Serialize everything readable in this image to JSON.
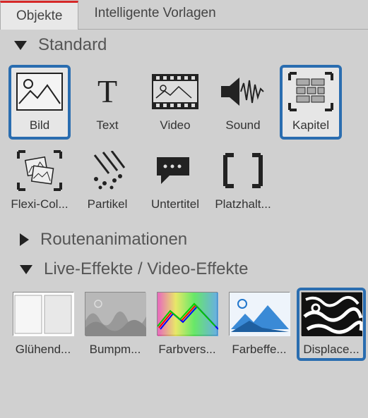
{
  "tabs": {
    "objects": "Objekte",
    "templates": "Intelligente Vorlagen"
  },
  "sections": {
    "standard": {
      "label": "Standard",
      "expanded": true
    },
    "routes": {
      "label": "Routenanimationen",
      "expanded": false
    },
    "live": {
      "label": "Live-Effekte / Video-Effekte",
      "expanded": true
    }
  },
  "standard_items": [
    {
      "key": "bild",
      "label": "Bild",
      "selected": true
    },
    {
      "key": "text",
      "label": "Text",
      "selected": false
    },
    {
      "key": "video",
      "label": "Video",
      "selected": false
    },
    {
      "key": "sound",
      "label": "Sound",
      "selected": false
    },
    {
      "key": "kapitel",
      "label": "Kapitel",
      "selected": true
    },
    {
      "key": "flexicol",
      "label": "Flexi-Col...",
      "selected": false
    },
    {
      "key": "partikel",
      "label": "Partikel",
      "selected": false
    },
    {
      "key": "untertitel",
      "label": "Untertitel",
      "selected": false
    },
    {
      "key": "platzhalt",
      "label": "Platzhalt...",
      "selected": false
    }
  ],
  "effects": [
    {
      "key": "gluehend",
      "label": "Glühend...",
      "selected": false
    },
    {
      "key": "bump",
      "label": "Bumpm...",
      "selected": false
    },
    {
      "key": "farbvers",
      "label": "Farbvers...",
      "selected": false
    },
    {
      "key": "farbeffe",
      "label": "Farbeffe...",
      "selected": false
    },
    {
      "key": "displace",
      "label": "Displace...",
      "selected": true
    }
  ]
}
